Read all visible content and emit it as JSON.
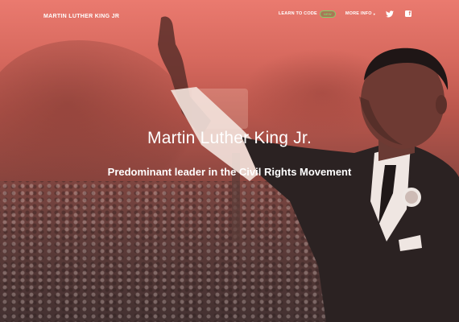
{
  "nav": {
    "brand": "MARTIN LUTHER KING JR",
    "learn_to_code": "LEARN TO CODE",
    "badge": "NEW",
    "more_info": "MORE INFO",
    "more_caret": "▾",
    "twitter_icon": "twitter-icon",
    "facebook_icon": "facebook-icon"
  },
  "hero": {
    "title": "Martin Luther King Jr.",
    "subtitle": "Predominant leader in the Civil Rights Movement"
  },
  "colors": {
    "gradient_top": "#ea7a6f",
    "gradient_bottom": "#342c2c",
    "badge_green": "#7fd36a",
    "text": "#ffffff"
  }
}
